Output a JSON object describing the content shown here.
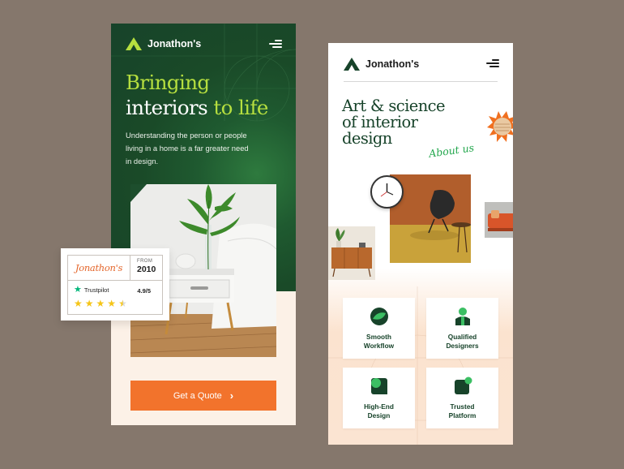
{
  "left_screen": {
    "brand": {
      "name": "Jonathon's",
      "logo_icon": "triangle-logo-icon"
    },
    "menu_icon": "hamburger-menu-icon",
    "headline": {
      "line1": "Bringing",
      "line2_white": "interiors",
      "line2_green": "to life"
    },
    "subtext": "Understanding the person or people living in a home is a far greater need in design.",
    "cta": {
      "label": "Get a Quote",
      "icon": "chevron-right-icon"
    },
    "colors": {
      "hero_bg": "#17432a",
      "accent_green": "#b6df3f",
      "cta": "#f2732c"
    }
  },
  "rating_card": {
    "logo_text": "Jonathon's",
    "from_label": "FROM",
    "year": "2010",
    "provider": "Trustpilot",
    "score": "4.9/5",
    "stars": 4.5
  },
  "right_screen": {
    "brand": {
      "name": "Jonathon's",
      "logo_icon": "triangle-logo-icon"
    },
    "menu_icon": "hamburger-menu-icon",
    "headline": {
      "line1": "Art & science",
      "line2": "of interior",
      "line3": "design"
    },
    "script_link": "About us",
    "features": [
      {
        "label_line1": "Smooth",
        "label_line2": "Workflow",
        "icon": "workflow-icon"
      },
      {
        "label_line1": "Qualified",
        "label_line2": "Designers",
        "icon": "designer-icon"
      },
      {
        "label_line1": "High-End",
        "label_line2": "Design",
        "icon": "design-icon"
      },
      {
        "label_line1": "Trusted",
        "label_line2": "Platform",
        "icon": "platform-icon"
      }
    ]
  }
}
